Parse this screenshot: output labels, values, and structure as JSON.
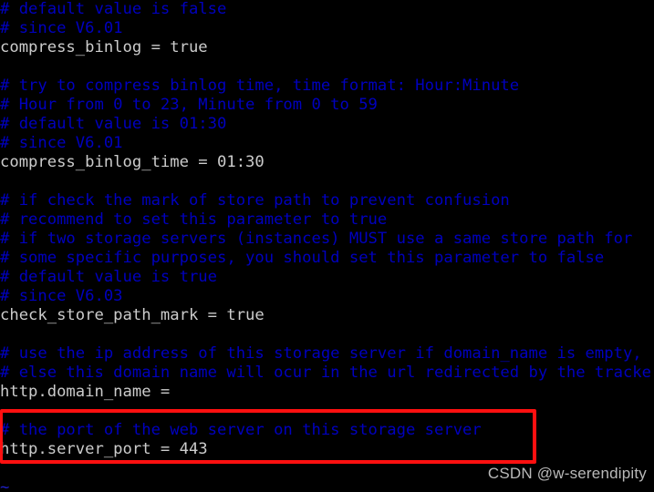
{
  "terminal": {
    "editor": "vim",
    "colors": {
      "background": "#000000",
      "comment": "#0000bf",
      "code": "#cccccc",
      "cursor_bg": "#00e000",
      "cursor_fg": "#101010",
      "tilde": "#2020c8",
      "highlight_box": "#ff1010",
      "watermark": "#b9b9b9"
    },
    "cursor": {
      "char": "h",
      "line_index": 24,
      "column": 0
    },
    "lines": [
      {
        "kind": "comment",
        "text": "# default value is false"
      },
      {
        "kind": "comment",
        "text": "# since V6.01"
      },
      {
        "kind": "code",
        "text": "compress_binlog = true"
      },
      {
        "kind": "blank",
        "text": ""
      },
      {
        "kind": "comment",
        "text": "# try to compress binlog time, time format: Hour:Minute"
      },
      {
        "kind": "comment",
        "text": "# Hour from 0 to 23, Minute from 0 to 59"
      },
      {
        "kind": "comment",
        "text": "# default value is 01:30"
      },
      {
        "kind": "comment",
        "text": "# since V6.01"
      },
      {
        "kind": "code",
        "text": "compress_binlog_time = 01:30"
      },
      {
        "kind": "blank",
        "text": ""
      },
      {
        "kind": "comment",
        "text": "# if check the mark of store path to prevent confusion"
      },
      {
        "kind": "comment",
        "text": "# recommend to set this parameter to true"
      },
      {
        "kind": "comment",
        "text": "# if two storage servers (instances) MUST use a same store path for"
      },
      {
        "kind": "comment",
        "text": "# some specific purposes, you should set this parameter to false"
      },
      {
        "kind": "comment",
        "text": "# default value is true"
      },
      {
        "kind": "comment",
        "text": "# since V6.03"
      },
      {
        "kind": "code",
        "text": "check_store_path_mark = true"
      },
      {
        "kind": "blank",
        "text": ""
      },
      {
        "kind": "comment",
        "text": "# use the ip address of this storage server if domain_name is empty,"
      },
      {
        "kind": "comment",
        "text": "# else this domain name will ocur in the url redirected by the tracker"
      },
      {
        "kind": "code",
        "text": "http.domain_name ="
      },
      {
        "kind": "blank",
        "text": ""
      },
      {
        "kind": "comment",
        "text": "# the port of the web server on this storage server"
      },
      {
        "kind": "code",
        "text": "http.server_port = 443"
      },
      {
        "kind": "blank",
        "text": ""
      },
      {
        "kind": "tilde",
        "text": "~"
      }
    ]
  },
  "annotation": {
    "highlight_label": "red-rectangle-around-http-server-port"
  },
  "watermark": {
    "text": "CSDN @w-serendipity"
  }
}
